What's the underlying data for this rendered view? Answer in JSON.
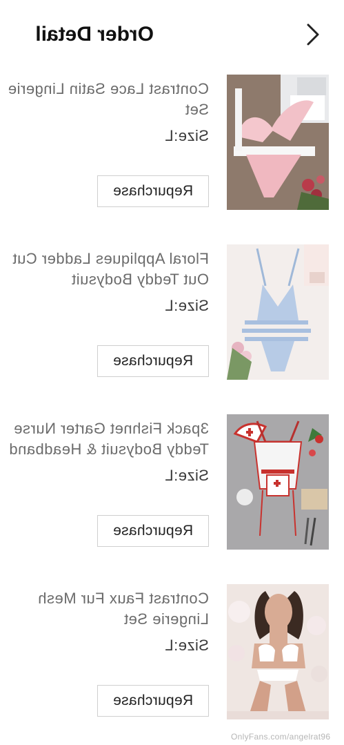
{
  "header": {
    "title": "Order Detail",
    "back_icon": "chevron-left-icon"
  },
  "items": [
    {
      "name": "Contrast Lace Satin Lingerie Set",
      "size": "Size:L",
      "button_label": "Repurchase"
    },
    {
      "name": "Floral Appliques Ladder Cut Out Teddy Bodysuit",
      "size": "Size:L",
      "button_label": "Repurchase"
    },
    {
      "name": "3pack Fishnet Garter Nurse Teddy Bodysuit & Headband",
      "size": "Size:L",
      "button_label": "Repurchase"
    },
    {
      "name": "Contrast Faux Fur Mesh Lingerie Set",
      "size": "Size:L",
      "button_label": "Repurchase"
    }
  ],
  "watermark": "OnlyFans.com/angelrat96"
}
